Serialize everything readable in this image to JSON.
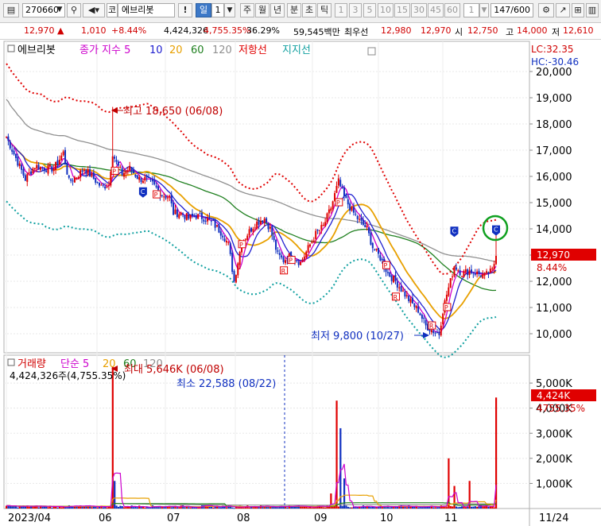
{
  "toolbar": {
    "code": "270660",
    "market_prefix": "코",
    "stock_name": "에브리봇",
    "period_selected": "일",
    "period_count": "1",
    "periods": [
      "주",
      "월",
      "년",
      "분",
      "초",
      "틱"
    ],
    "minutes": [
      "1",
      "3",
      "5",
      "10",
      "15",
      "30",
      "45",
      "60"
    ],
    "unit": "1",
    "count": "147/600"
  },
  "info": {
    "price": "12,970 ▲",
    "change": "1,010",
    "change_pct": "+8.44%",
    "volume": "4,424,326",
    "volume_ratio": "4,755.35%",
    "turnover": "36.29%",
    "amount": "59,545백만",
    "label_conv": "최우선",
    "conv_price": "12,980",
    "conv_price2": "12,970",
    "label_open": "시",
    "open": "12,750",
    "label_high": "고",
    "high": "14,000",
    "label_low": "저",
    "low": "12,610"
  },
  "price_panel": {
    "legend": {
      "name": "에브리봇",
      "ma_label": "종가 지수 5",
      "ma10": "10",
      "ma20": "20",
      "ma60": "60",
      "ma120": "120",
      "resistance": "저항선",
      "support": "지지선"
    },
    "lc": "LC:32.35",
    "hc": "HC:-30.46",
    "y_ticks": [
      "20,000",
      "19,000",
      "18,000",
      "17,000",
      "16,000",
      "15,000",
      "14,000",
      "13,000",
      "12,000",
      "11,000",
      "10,000"
    ],
    "current_price_tag": "12,970",
    "current_pct": "8.44%",
    "high_annotation": "최고 18,650 (06/08)",
    "low_annotation": "최저 9,800 (10/27)"
  },
  "volume_panel": {
    "legend": {
      "name": "거래량",
      "ma_label": "단순 5",
      "ma20": "20",
      "ma60": "60",
      "ma120": "120"
    },
    "volume_text": "4,424,326주(4,755.35%)",
    "max_annotation": "최대 5,646K (06/08)",
    "min_annotation": "최소 22,588 (08/22)",
    "y_ticks": [
      "5,000K",
      "4,000K",
      "3,000K",
      "2,000K",
      "1,000K"
    ],
    "current_tag": "4,424K",
    "current_pct": "4755.35%"
  },
  "x_axis": [
    "2023/04",
    "06",
    "07",
    "08",
    "09",
    "10",
    "11",
    "11/24"
  ],
  "chart_data": {
    "type": "candlestick",
    "price_axis_range": [
      9500,
      20500
    ],
    "volume_axis_range": [
      0,
      5800000
    ],
    "price_path": [
      [
        0,
        17500
      ],
      [
        5,
        16700
      ],
      [
        10,
        15900
      ],
      [
        15,
        16400
      ],
      [
        20,
        16300
      ],
      [
        25,
        16300
      ],
      [
        30,
        16900
      ],
      [
        33,
        15800
      ],
      [
        37,
        16000
      ],
      [
        41,
        16300
      ],
      [
        45,
        16000
      ],
      [
        50,
        15600
      ],
      [
        54,
        15700
      ],
      [
        56,
        16900
      ],
      [
        58,
        16500
      ],
      [
        61,
        16100
      ],
      [
        65,
        16300
      ],
      [
        70,
        15900
      ],
      [
        73,
        15900
      ],
      [
        77,
        15700
      ],
      [
        82,
        15300
      ],
      [
        86,
        15200
      ],
      [
        88,
        14600
      ],
      [
        92,
        14600
      ],
      [
        96,
        14400
      ],
      [
        100,
        14500
      ],
      [
        105,
        14400
      ],
      [
        109,
        14200
      ],
      [
        114,
        13800
      ],
      [
        117,
        13400
      ],
      [
        120,
        12000
      ],
      [
        124,
        13500
      ],
      [
        128,
        13900
      ],
      [
        131,
        14200
      ],
      [
        136,
        14400
      ],
      [
        139,
        14000
      ],
      [
        143,
        13000
      ],
      [
        146,
        12800
      ],
      [
        150,
        13000
      ],
      [
        155,
        12700
      ],
      [
        160,
        13400
      ],
      [
        163,
        13800
      ],
      [
        167,
        14100
      ],
      [
        171,
        14800
      ],
      [
        175,
        15800
      ],
      [
        178,
        15200
      ],
      [
        182,
        14700
      ],
      [
        186,
        14300
      ],
      [
        190,
        14000
      ],
      [
        193,
        13300
      ],
      [
        197,
        12900
      ],
      [
        201,
        12300
      ],
      [
        205,
        12000
      ],
      [
        209,
        11600
      ],
      [
        213,
        11200
      ],
      [
        217,
        10900
      ],
      [
        221,
        10300
      ],
      [
        225,
        10100
      ],
      [
        228,
        10000
      ],
      [
        230,
        10900
      ],
      [
        232,
        11500
      ],
      [
        234,
        12000
      ],
      [
        236,
        12600
      ],
      [
        240,
        12300
      ],
      [
        244,
        12400
      ],
      [
        248,
        12300
      ],
      [
        252,
        12200
      ],
      [
        256,
        12400
      ],
      [
        258,
        12970
      ]
    ],
    "high_price": 18650,
    "high_date": "06/08",
    "low_price": 9800,
    "low_date": "10/27",
    "last_close": 12970,
    "volume_highlights": [
      {
        "date": "06/08",
        "value": 5646000
      },
      {
        "date": "09 (early)",
        "value": 4300000
      },
      {
        "date": "09 (early, second spike)",
        "value": 3200000
      },
      {
        "date": "08/22",
        "value": 22588
      },
      {
        "date": "11 (early)",
        "value": 2000000
      },
      {
        "date": "11/24",
        "value": 4424000
      }
    ],
    "series": [
      {
        "name": "종가 지수 5",
        "color": "#cc00cc"
      },
      {
        "name": "10",
        "color": "#2020d0"
      },
      {
        "name": "20",
        "color": "#e8a000"
      },
      {
        "name": "60",
        "color": "#208020"
      },
      {
        "name": "120",
        "color": "#909090"
      },
      {
        "name": "저항선",
        "color": "#e00000"
      },
      {
        "name": "지지선",
        "color": "#10a0a0"
      }
    ],
    "colors": {
      "up": "#e00000",
      "down": "#1030c0",
      "text_up": "#d00000",
      "bg": "#ffffff"
    }
  }
}
